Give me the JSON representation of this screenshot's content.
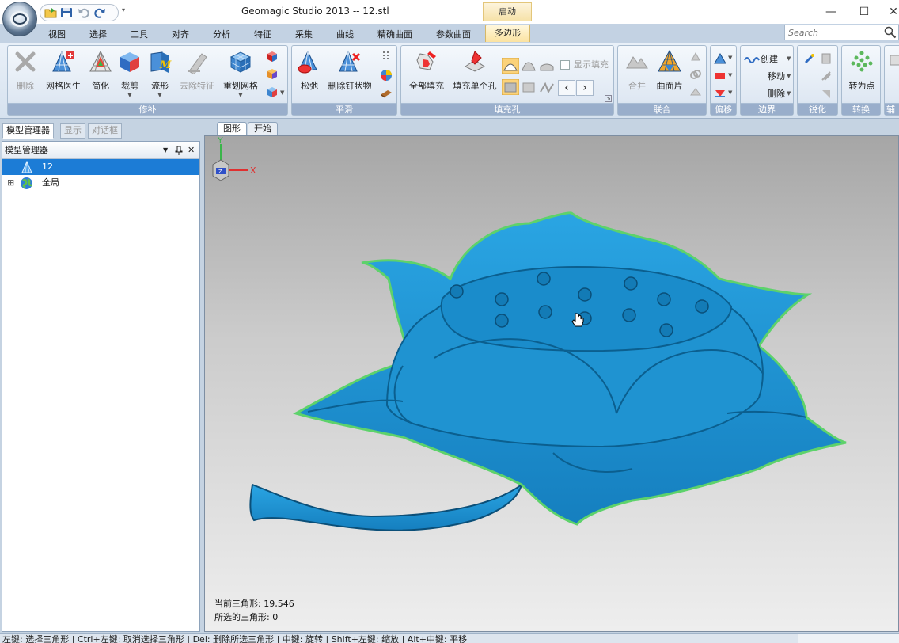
{
  "window": {
    "title": "Geomagic Studio 2013 -- 12.stl",
    "context_tab_group": "启动"
  },
  "tabs": [
    "视图",
    "选择",
    "工具",
    "对齐",
    "分析",
    "特征",
    "采集",
    "曲线",
    "精确曲面",
    "参数曲面"
  ],
  "active_tab": "多边形",
  "search": {
    "placeholder": "Search"
  },
  "ribbon": {
    "repair": {
      "label": "修补",
      "delete": "删除",
      "mesh_doctor": "网格医生",
      "simplify": "简化",
      "trim": "裁剪",
      "flow": "流形",
      "remove_features": "去除特征",
      "remesh": "重划网格"
    },
    "smooth": {
      "label": "平滑",
      "relax": "松弛",
      "remove_spikes": "删除钉状物"
    },
    "fill": {
      "label": "填充孔",
      "fill_all": "全部填充",
      "fill_single": "填充单个孔",
      "show_fill": "显示填充"
    },
    "combine": {
      "label": "联合",
      "merge": "合并",
      "patch": "曲面片"
    },
    "offset": {
      "label": "偏移"
    },
    "boundary": {
      "label": "边界",
      "create": "创建",
      "move": "移动",
      "delete": "删除"
    },
    "sharpen": {
      "label": "锐化"
    },
    "convert": {
      "label": "转换",
      "to_points": "转为点"
    },
    "aux": {
      "label": "辅"
    }
  },
  "left_panel": {
    "tabs": [
      "模型管理器",
      "显示",
      "对话框"
    ],
    "header": "模型管理器",
    "tree": [
      {
        "label": "12",
        "icon": "mesh-icon",
        "selected": true
      },
      {
        "label": "全局",
        "icon": "globe-icon",
        "selected": false,
        "expander": "⊞"
      }
    ]
  },
  "viewport": {
    "tabs": [
      "图形",
      "开始"
    ],
    "stats": {
      "current_triangles": "当前三角形: 19,546",
      "selected_triangles": "所选的三角形: 0"
    },
    "axis": {
      "y": "Y",
      "x": "X",
      "z": "Z"
    }
  },
  "status_bar": "左键: 选择三角形 | Ctrl+左键: 取消选择三角形 | Del: 删除所选三角形 | 中键: 旋转 | Shift+左键: 缩放 | Alt+中键: 平移",
  "colors": {
    "mesh": "#1e9ad6",
    "mesh_dark": "#0b5f8f",
    "selection": "#1c7cd6",
    "context_tab": "#fbe3a1"
  }
}
